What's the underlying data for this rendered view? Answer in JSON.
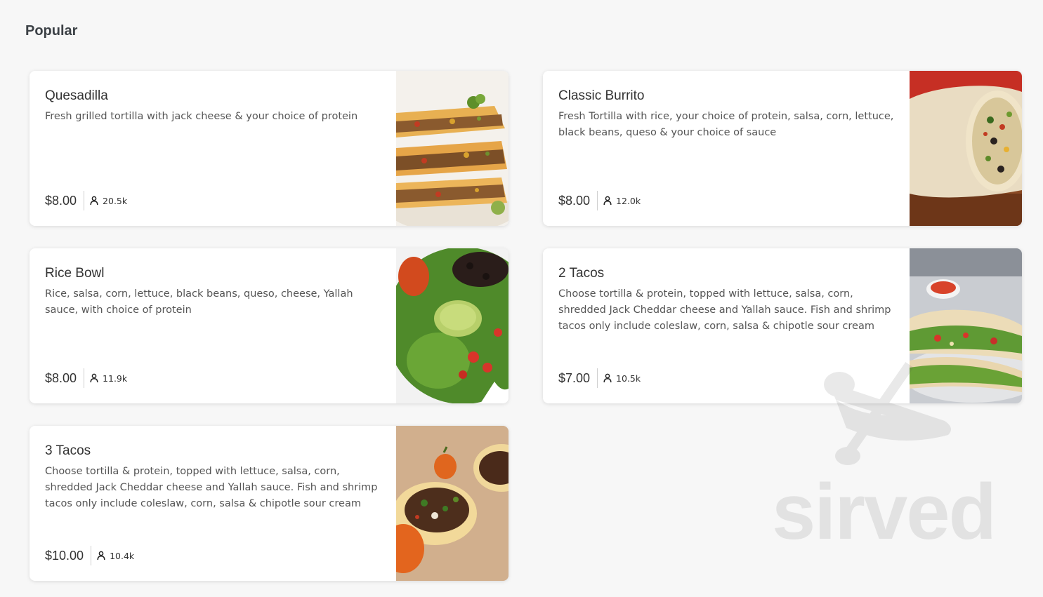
{
  "section": {
    "title": "Popular"
  },
  "items": [
    {
      "name": "Quesadilla",
      "description": "Fresh grilled tortilla with jack cheese & your choice of protein",
      "price": "$8.00",
      "count": "20.5k",
      "image_icon": "quesadilla-photo"
    },
    {
      "name": "Classic Burrito",
      "description": "Fresh Tortilla with rice, your choice of protein, salsa, corn, lettuce, black beans, queso & your choice of sauce",
      "price": "$8.00",
      "count": "12.0k",
      "image_icon": "burrito-photo"
    },
    {
      "name": "Rice Bowl",
      "description": "Rice, salsa, corn, lettuce, black beans, queso, cheese, Yallah sauce, with choice of protein",
      "price": "$8.00",
      "count": "11.9k",
      "image_icon": "rice-bowl-photo"
    },
    {
      "name": "2 Tacos",
      "description": "Choose tortilla & protein, topped with lettuce, salsa, corn, shredded Jack Cheddar cheese and Yallah sauce. Fish and shrimp tacos only include coleslaw, corn, salsa & chipotle sour cream",
      "price": "$7.00",
      "count": "10.5k",
      "image_icon": "tacos-photo"
    },
    {
      "name": "3 Tacos",
      "description": "Choose tortilla & protein, topped with lettuce, salsa, corn, shredded Jack Cheddar cheese and Yallah sauce. Fish and shrimp tacos only include coleslaw, corn, salsa & chipotle sour cream",
      "price": "$10.00",
      "count": "10.4k",
      "image_icon": "tacos-board-photo"
    }
  ],
  "watermark": {
    "text": "sirved"
  },
  "colors": {
    "background": "#f7f7f7",
    "card": "#ffffff",
    "title": "#3c4146"
  }
}
